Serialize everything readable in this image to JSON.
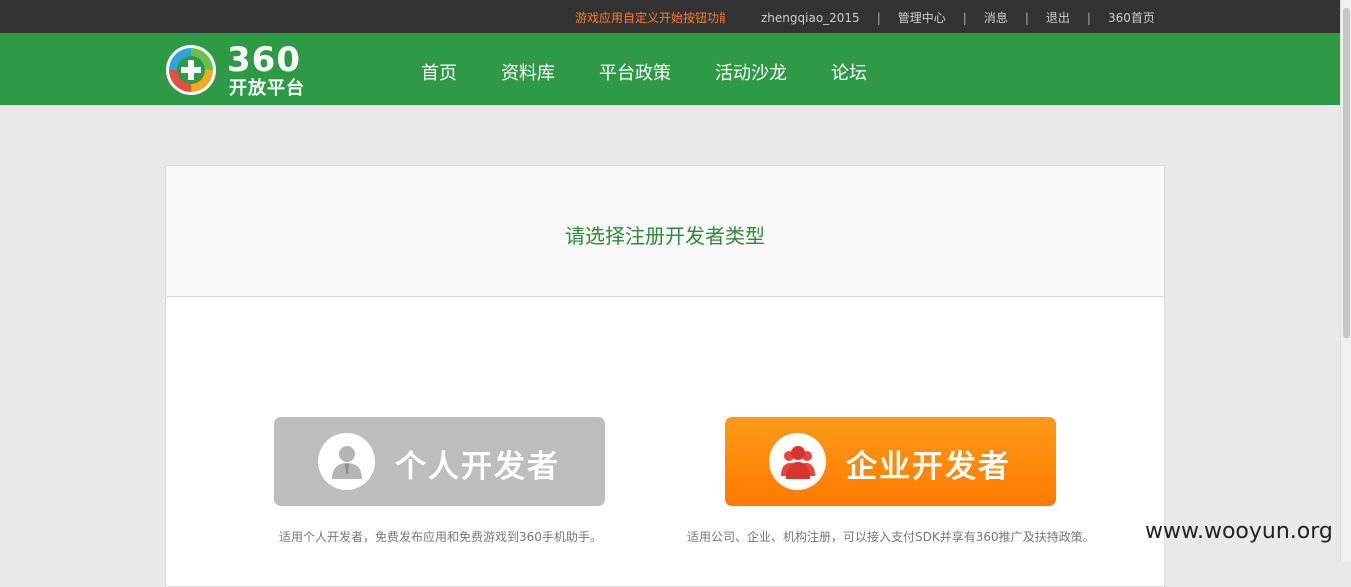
{
  "topbar": {
    "notice": "游戏应用自定义开始按钮功能",
    "username": "zhengqiao_2015",
    "links": [
      "管理中心",
      "消息",
      "退出",
      "360首页"
    ],
    "separator": "|"
  },
  "header": {
    "logo_number": "360",
    "logo_text": "开放平台",
    "nav": [
      "首页",
      "资料库",
      "平台政策",
      "活动沙龙",
      "论坛"
    ]
  },
  "main": {
    "title": "请选择注册开发者类型",
    "personal": {
      "label": "个人开发者",
      "desc": "适用个人开发者，免费发布应用和免费游戏到360手机助手。"
    },
    "company": {
      "label": "企业开发者",
      "desc": "适用公司、企业、机构注册，可以接入支付SDK并享有360推广及扶持政策。"
    }
  },
  "watermark": "www.wooyun.org",
  "colors": {
    "brand_green": "#2e9a45",
    "topbar": "#333333",
    "accent_orange": "#ff7a00",
    "disabled_gray": "#bdbdbd",
    "title_green": "#2e8a3c"
  }
}
